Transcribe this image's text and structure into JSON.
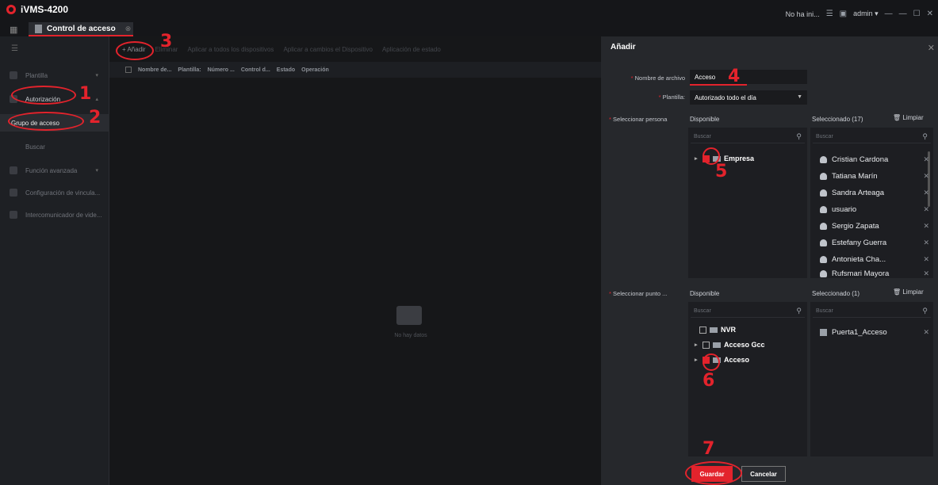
{
  "app": {
    "title": "iVMS-4200",
    "notice": "No ha ini...",
    "user": "admin ▾",
    "controls": [
      "☰",
      "▣",
      "⎕",
      "—",
      "☐",
      "✕"
    ]
  },
  "tab": {
    "label": "Control de acceso",
    "close": "⊗"
  },
  "sidebar": {
    "items": [
      {
        "label": "Plantilla",
        "chev": "▾"
      },
      {
        "label": "Autorización",
        "chev": "▴"
      },
      {
        "label": "Grupo de acceso"
      },
      {
        "label": "Buscar"
      },
      {
        "label": "Función avanzada",
        "chev": "▾"
      },
      {
        "label": "Configuración de vincula..."
      },
      {
        "label": "Intercomunicador de vide..."
      }
    ]
  },
  "toolbar": {
    "items": [
      "+ Añadir",
      "Eliminar",
      "Aplicar a todos los dispositivos",
      "Aplicar a cambios el Dispositivo",
      "Aplicación de estado"
    ]
  },
  "table": {
    "headers": [
      "Nombre de...",
      "Plantilla:",
      "Número ...",
      "Control d...",
      "Estado",
      "Operación"
    ]
  },
  "empty_text": "No hay datos",
  "panel": {
    "title": "Añadir",
    "file_label": "Nombre de archivo",
    "file_value": "Acceso",
    "template_label": "Plantilla:",
    "template_value": "Autorizado todo el día",
    "person_label": "Seleccionar persona",
    "available": "Disponible",
    "selected_persons": "Seleccionado (17)",
    "clear": "Limpiar",
    "search": "Buscar",
    "person_tree": [
      {
        "label": "Empresa",
        "checked": true
      }
    ],
    "persons": [
      "Cristian Cardona",
      "Tatiana Marín",
      "Sandra Arteaga",
      "usuario",
      "Sergio Zapata",
      "Estefany Guerra",
      "Antonieta Cha...",
      "Rufsmari Mayora"
    ],
    "point_label": "Seleccionar punto ...",
    "selected_points": "Seleccionado (1)",
    "point_tree": [
      {
        "label": "NVR",
        "checked": false
      },
      {
        "label": "Acceso Gcc",
        "checked": false
      },
      {
        "label": "Acceso",
        "checked": true
      }
    ],
    "points": [
      "Puerta1_Acceso"
    ],
    "save": "Guardar",
    "cancel": "Cancelar"
  },
  "annotations": [
    "1",
    "2",
    "3",
    "4",
    "5",
    "6",
    "7"
  ],
  "colors": {
    "accent": "#e3232c",
    "bg": "#1a1b1f",
    "panel": "#26282c"
  }
}
